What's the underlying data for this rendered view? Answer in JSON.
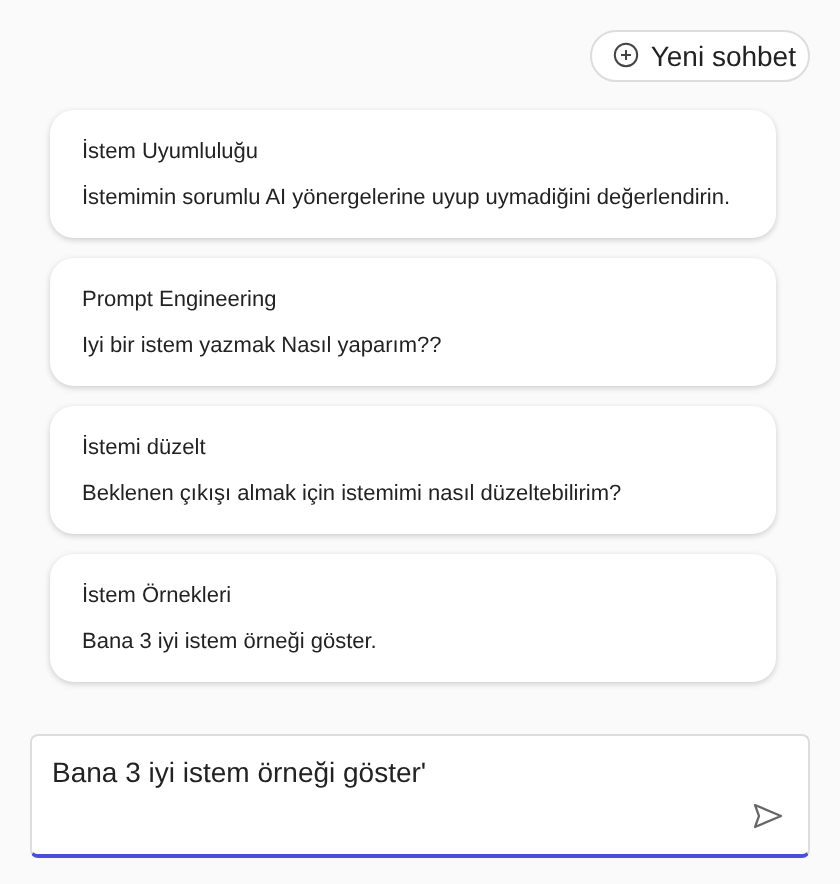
{
  "new_chat_button": {
    "label": "Yeni sohbet"
  },
  "suggestions": [
    {
      "title": "İstem Uyumluluğu",
      "prompt": "İstemimin sorumlu AI yönergelerine uyup uymadiğini değerlendirin."
    },
    {
      "title": "Prompt Engineering",
      "prompt": "Iyi bir istem yazmak Nasıl yaparım??"
    },
    {
      "title": "İstemi düzelt",
      "prompt": "Beklenen çıkışı almak için istemimi nasıl düzeltebilirim?"
    },
    {
      "title": "İstem Örnekleri",
      "prompt": "Bana 3 iyi istem örneği göster."
    }
  ],
  "composer": {
    "value": "Bana 3 iyi istem örneği göster'"
  }
}
